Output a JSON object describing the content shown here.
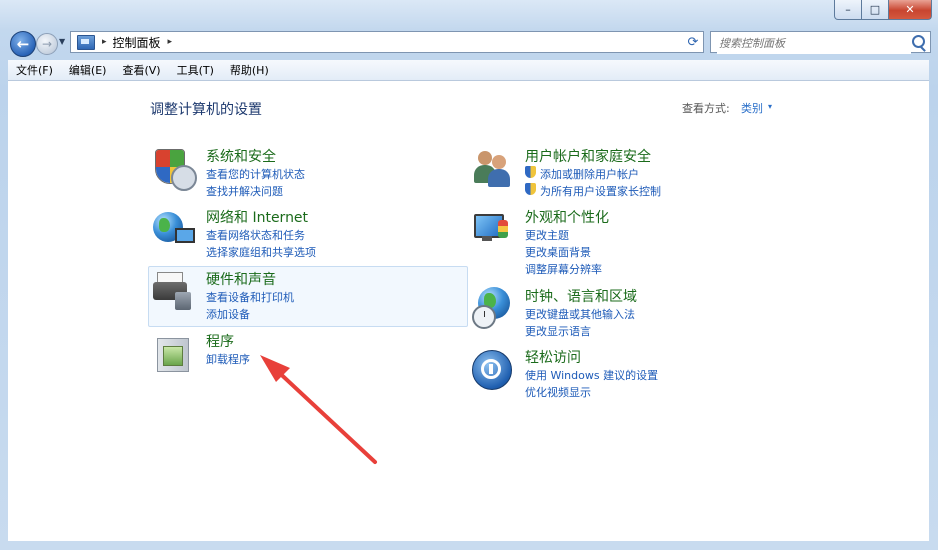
{
  "window": {
    "minimize_glyph": "–",
    "maximize_glyph": "□",
    "close_glyph": "✕"
  },
  "address": {
    "separator": "▸",
    "path": "控制面板",
    "trail": "▸",
    "dropdown": "▾",
    "refresh": "⟳"
  },
  "search": {
    "placeholder": "搜索控制面板"
  },
  "menu": [
    "文件(F)",
    "编辑(E)",
    "查看(V)",
    "工具(T)",
    "帮助(H)"
  ],
  "page": {
    "title": "调整计算机的设置",
    "view_by_label": "查看方式:",
    "view_by_value": "类别",
    "view_by_arrow": "▾"
  },
  "categories_left": [
    {
      "title": "系统和安全",
      "links": [
        "查看您的计算机状态",
        "查找并解决问题"
      ]
    },
    {
      "title": "网络和 Internet",
      "links": [
        "查看网络状态和任务",
        "选择家庭组和共享选项"
      ]
    },
    {
      "title": "硬件和声音",
      "links": [
        "查看设备和打印机",
        "添加设备"
      ]
    },
    {
      "title": "程序",
      "links": [
        "卸载程序"
      ]
    }
  ],
  "categories_right": [
    {
      "title": "用户帐户和家庭安全",
      "links": [
        "添加或删除用户帐户",
        "为所有用户设置家长控制"
      ]
    },
    {
      "title": "外观和个性化",
      "links": [
        "更改主题",
        "更改桌面背景",
        "调整屏幕分辨率"
      ]
    },
    {
      "title": "时钟、语言和区域",
      "links": [
        "更改键盘或其他输入法",
        "更改显示语言"
      ]
    },
    {
      "title": "轻松访问",
      "links": [
        "使用 Windows 建议的设置",
        "优化视频显示"
      ]
    }
  ],
  "colors": {
    "category_title": "#1b6b1b",
    "link": "#1e5bb8",
    "annotation_arrow": "#e8403a"
  },
  "icons": {
    "system_security": "shield-icon",
    "network": "network-globe-icon",
    "hardware": "printer-icon",
    "programs": "programs-icon",
    "user_accounts": "users-icon",
    "appearance": "monitor-paint-icon",
    "clock_region": "globe-clock-icon",
    "ease_of_access": "ease-of-access-icon"
  }
}
